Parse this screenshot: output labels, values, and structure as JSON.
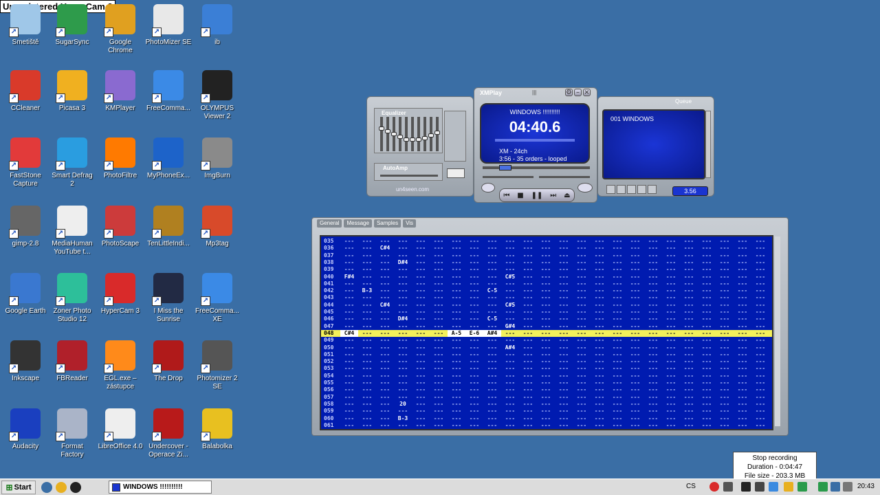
{
  "watermark": "Unregistered HyperCam 3",
  "desktop_icons": [
    {
      "label": "Smetiště"
    },
    {
      "label": "SugarSync"
    },
    {
      "label": "Google\nChrome"
    },
    {
      "label": "PhotoMizer SE"
    },
    {
      "label": "ib"
    },
    {
      "label": "CCleaner"
    },
    {
      "label": "Picasa 3"
    },
    {
      "label": "KMPlayer"
    },
    {
      "label": "FreeComma..."
    },
    {
      "label": "OLYMPUS\nViewer 2"
    },
    {
      "label": "FastStone\nCapture"
    },
    {
      "label": "Smart Defrag\n2"
    },
    {
      "label": "PhotoFiltre"
    },
    {
      "label": "MyPhoneEx..."
    },
    {
      "label": "ImgBurn"
    },
    {
      "label": "gimp-2.8"
    },
    {
      "label": "MediaHuman\nYouTube t..."
    },
    {
      "label": "PhotoScape"
    },
    {
      "label": "TenLittleIndi..."
    },
    {
      "label": "Mp3tag"
    },
    {
      "label": "Google Earth"
    },
    {
      "label": "Zoner Photo\nStudio 12"
    },
    {
      "label": "HyperCam 3"
    },
    {
      "label": "I Miss the\nSunrise"
    },
    {
      "label": "FreeComma...\nXE"
    },
    {
      "label": "Inkscape"
    },
    {
      "label": "FBReader"
    },
    {
      "label": "EGL.exe –\nzástupce"
    },
    {
      "label": "The Drop"
    },
    {
      "label": "Photomizer 2\nSE"
    },
    {
      "label": "Audacity"
    },
    {
      "label": "Format\nFactory"
    },
    {
      "label": "LibreOffice 4.0"
    },
    {
      "label": "Undercover -\nOperace Zi..."
    },
    {
      "label": "Balabolka"
    }
  ],
  "icon_colors": [
    "#9fc7e8",
    "#2e9b4b",
    "#e0a020",
    "#e8e8e8",
    "#3b7fd6",
    "#d93a2a",
    "#f0b020",
    "#8a6ad0",
    "#3b8ae6",
    "#222222",
    "#e23a3a",
    "#2a9de0",
    "#ff7a00",
    "#1d63c9",
    "#8a8a8a",
    "#666666",
    "#eeeeee",
    "#cc3b3b",
    "#b08020",
    "#d84a2a",
    "#3a78d0",
    "#2dbf9a",
    "#d92a2a",
    "#222a44",
    "#3b8ae6",
    "#333333",
    "#b0202a",
    "#ff8a1a",
    "#b01a1a",
    "#555555",
    "#1a3fbf",
    "#aab4c8",
    "#eeeeee",
    "#b81a1a",
    "#e8c020"
  ],
  "xmplay": {
    "title": "XMPlay",
    "song_title": "WINDOWS !!!!!!!!!!",
    "time": "04:40.6",
    "info1": "XM - 24ch",
    "info2": "3:56 - 35 orders - looped",
    "equalizer_label": "Equalizer",
    "autoamp_label": "AutoAmp",
    "brand": "un4seen.com",
    "queue_label": "Queue",
    "playlist_entry": "001 WINDOWS",
    "playlist_time": "3.56"
  },
  "pattern": {
    "tabs": [
      "General",
      "Message",
      "Samples",
      "Vis"
    ],
    "rows": [
      {
        "num": "035",
        "cells": {}
      },
      {
        "num": "036",
        "cells": {
          "2": "C#4"
        }
      },
      {
        "num": "037",
        "cells": {}
      },
      {
        "num": "038",
        "cells": {
          "3": "D#4"
        }
      },
      {
        "num": "039",
        "cells": {}
      },
      {
        "num": "040",
        "cells": {
          "0": "F#4",
          "9": "C#5"
        }
      },
      {
        "num": "041",
        "cells": {}
      },
      {
        "num": "042",
        "cells": {
          "1": "B-3",
          "8": "C-5"
        }
      },
      {
        "num": "043",
        "cells": {}
      },
      {
        "num": "044",
        "cells": {
          "2": "C#4",
          "9": "C#5"
        }
      },
      {
        "num": "045",
        "cells": {}
      },
      {
        "num": "046",
        "cells": {
          "3": "D#4",
          "8": "C-5"
        }
      },
      {
        "num": "047",
        "cells": {
          "9": "G#4"
        }
      },
      {
        "num": "048",
        "cells": {
          "0": "C#4",
          "6": "A-5",
          "7": "E-6",
          "8": "A#4"
        },
        "selected": true
      },
      {
        "num": "049",
        "cells": {}
      },
      {
        "num": "050",
        "cells": {
          "9": "A#4"
        }
      },
      {
        "num": "051",
        "cells": {}
      },
      {
        "num": "052",
        "cells": {}
      },
      {
        "num": "053",
        "cells": {}
      },
      {
        "num": "054",
        "cells": {}
      },
      {
        "num": "055",
        "cells": {}
      },
      {
        "num": "056",
        "cells": {}
      },
      {
        "num": "057",
        "cells": {}
      },
      {
        "num": "058",
        "cells": {
          "3": "20"
        }
      },
      {
        "num": "059",
        "cells": {}
      },
      {
        "num": "060",
        "cells": {
          "3": "B-3"
        }
      },
      {
        "num": "061",
        "cells": {}
      }
    ]
  },
  "tooltip": {
    "line1": "Stop recording",
    "line2": "Duration - 0:04:47",
    "line3": "File size - 203.3 MB"
  },
  "taskbar": {
    "start": "Start",
    "task_label": "WINDOWS !!!!!!!!!!",
    "lang": "CS",
    "clock": "20:43"
  }
}
